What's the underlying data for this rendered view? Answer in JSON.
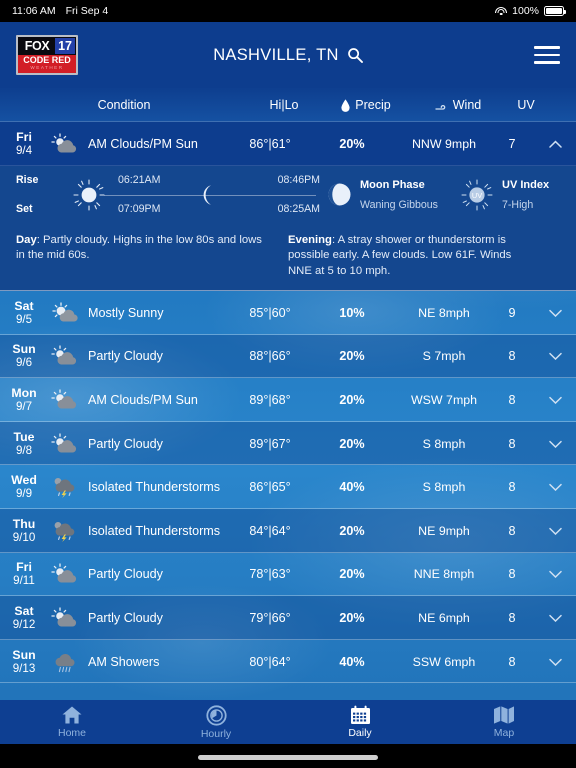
{
  "statusbar": {
    "time": "11:06 AM",
    "date": "Fri Sep 4",
    "battery": "100%"
  },
  "header": {
    "logo": {
      "fox": "FOX",
      "num": "17",
      "code_red": "CODE RED",
      "weather": "WEATHER"
    },
    "city": "NASHVILLE, TN",
    "search_icon": "search-icon",
    "menu_icon": "hamburger-icon"
  },
  "columns": {
    "condition": "Condition",
    "hilo": "Hi|Lo",
    "precip": "Precip",
    "wind": "Wind",
    "uv": "UV"
  },
  "colors": {
    "header_blue": "#0d3d8e",
    "sky_blue": "#2178c0",
    "detail_navy": "#14478f",
    "tabbar_blue": "#0e3f92",
    "active_tab": "#ffffff",
    "inactive_tab": "#8fb2dd",
    "logo_red": "#d21e26"
  },
  "forecast": [
    {
      "day": "Fri",
      "date": "9/4",
      "icon": "sun-behind-cloud-icon",
      "condition": "AM Clouds/PM Sun",
      "hilo": "86°|61°",
      "precip": "20%",
      "wind": "NNW 9mph",
      "uv": "7",
      "expanded": true,
      "chevron": "chevron-up-icon"
    },
    {
      "day": "Sat",
      "date": "9/5",
      "icon": "sun-behind-small-cloud-icon",
      "condition": "Mostly Sunny",
      "hilo": "85°|60°",
      "precip": "10%",
      "wind": "NE 8mph",
      "uv": "9",
      "expanded": false,
      "chevron": "chevron-down-icon"
    },
    {
      "day": "Sun",
      "date": "9/6",
      "icon": "sun-behind-cloud-icon",
      "condition": "Partly Cloudy",
      "hilo": "88°|66°",
      "precip": "20%",
      "wind": "S 7mph",
      "uv": "8",
      "expanded": false,
      "chevron": "chevron-down-icon"
    },
    {
      "day": "Mon",
      "date": "9/7",
      "icon": "sun-behind-cloud-icon",
      "condition": "AM Clouds/PM Sun",
      "hilo": "89°|68°",
      "precip": "20%",
      "wind": "WSW 7mph",
      "uv": "8",
      "expanded": false,
      "chevron": "chevron-down-icon"
    },
    {
      "day": "Tue",
      "date": "9/8",
      "icon": "sun-behind-cloud-icon",
      "condition": "Partly Cloudy",
      "hilo": "89°|67°",
      "precip": "20%",
      "wind": "S 8mph",
      "uv": "8",
      "expanded": false,
      "chevron": "chevron-down-icon"
    },
    {
      "day": "Wed",
      "date": "9/9",
      "icon": "thunderstorm-icon",
      "condition": "Isolated Thunderstorms",
      "hilo": "86°|65°",
      "precip": "40%",
      "wind": "S 8mph",
      "uv": "8",
      "expanded": false,
      "chevron": "chevron-down-icon"
    },
    {
      "day": "Thu",
      "date": "9/10",
      "icon": "thunderstorm-icon",
      "condition": "Isolated Thunderstorms",
      "hilo": "84°|64°",
      "precip": "20%",
      "wind": "NE 9mph",
      "uv": "8",
      "expanded": false,
      "chevron": "chevron-down-icon"
    },
    {
      "day": "Fri",
      "date": "9/11",
      "icon": "sun-behind-cloud-icon",
      "condition": "Partly Cloudy",
      "hilo": "78°|63°",
      "precip": "20%",
      "wind": "NNE 8mph",
      "uv": "8",
      "expanded": false,
      "chevron": "chevron-down-icon"
    },
    {
      "day": "Sat",
      "date": "9/12",
      "icon": "sun-behind-cloud-icon",
      "condition": "Partly Cloudy",
      "hilo": "79°|66°",
      "precip": "20%",
      "wind": "NE 6mph",
      "uv": "8",
      "expanded": false,
      "chevron": "chevron-down-icon"
    },
    {
      "day": "Sun",
      "date": "9/13",
      "icon": "rain-showers-icon",
      "condition": "AM Showers",
      "hilo": "80°|64°",
      "precip": "40%",
      "wind": "SSW 6mph",
      "uv": "8",
      "expanded": false,
      "chevron": "chevron-down-icon"
    }
  ],
  "detail": {
    "rise_label": "Rise",
    "set_label": "Set",
    "sun_rise": "06:21AM",
    "sun_set": "07:09PM",
    "moon_rise": "08:46PM",
    "moon_set": "08:25AM",
    "moon_phase_label": "Moon Phase",
    "moon_phase_value": "Waning Gibbous",
    "uv_index_label": "UV Index",
    "uv_index_value": "7-High",
    "uv_badge": "UV",
    "day_label": "Day",
    "day_text": ": Partly cloudy. Highs in the low 80s and lows in the mid 60s.",
    "evening_label": "Evening",
    "evening_text": ": A stray shower or thunderstorm is possible early. A few clouds. Low 61F. Winds NNE at 5 to 10 mph."
  },
  "tabs": [
    {
      "label": "Home",
      "icon": "home-icon",
      "active": false
    },
    {
      "label": "Hourly",
      "icon": "clock-icon",
      "active": false
    },
    {
      "label": "Daily",
      "icon": "calendar-icon",
      "active": true
    },
    {
      "label": "Map",
      "icon": "map-icon",
      "active": false
    }
  ]
}
